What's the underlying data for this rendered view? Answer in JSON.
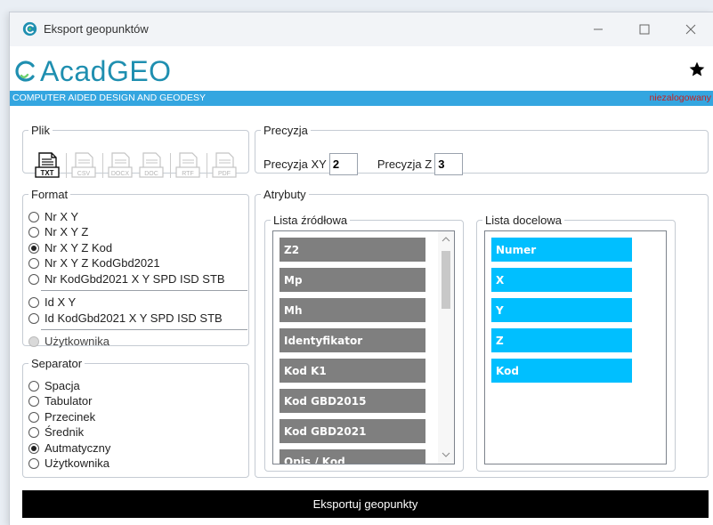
{
  "window": {
    "title": "Eksport geopunktów",
    "minimize_icon": "minimize-icon",
    "maximize_icon": "maximize-icon",
    "close_icon": "close-icon"
  },
  "header": {
    "logo_text": "AcadGEO",
    "tagline": "COMPUTER AIDED DESIGN AND GEODESY",
    "login_status": "niezalogowany",
    "favorite_icon": "star-icon"
  },
  "colors": {
    "accent_blue": "#34a6e0",
    "list_blue": "#00bfff",
    "list_gray": "#7f7f7f",
    "logo_color": "#1f8fb0",
    "status_red": "#c81e1e"
  },
  "plik": {
    "legend": "Plik",
    "buttons": [
      {
        "label": "TXT",
        "enabled": true
      },
      {
        "label": "CSV",
        "enabled": false
      },
      {
        "label": "DOCX",
        "enabled": false
      },
      {
        "label": "DOC",
        "enabled": false
      },
      {
        "label": "RTF",
        "enabled": false
      },
      {
        "label": "PDF",
        "enabled": false
      }
    ]
  },
  "precyzja": {
    "legend": "Precyzja",
    "xy_label": "Precyzja XY",
    "xy_value": "2",
    "z_label": "Precyzja Z",
    "z_value": "3"
  },
  "format": {
    "legend": "Format",
    "options": [
      {
        "label": "Nr X Y",
        "checked": false
      },
      {
        "label": "Nr X Y Z",
        "checked": false
      },
      {
        "label": "Nr X Y Z Kod",
        "checked": true
      },
      {
        "label": "Nr X Y Z KodGbd2021",
        "checked": false
      },
      {
        "label": "Nr KodGbd2021 X Y SPD ISD STB",
        "checked": false
      },
      {
        "label": "Id X Y",
        "checked": false
      },
      {
        "label": "Id KodGbd2021 X Y SPD ISD STB",
        "checked": false
      },
      {
        "label": "Użytkownika",
        "checked": false,
        "disabled": true
      }
    ]
  },
  "separator": {
    "legend": "Separator",
    "options": [
      {
        "label": "Spacja",
        "checked": false
      },
      {
        "label": "Tabulator",
        "checked": false
      },
      {
        "label": "Przecinek",
        "checked": false
      },
      {
        "label": "Średnik",
        "checked": false
      },
      {
        "label": "Autmatyczny",
        "checked": true
      },
      {
        "label": "Użytkownika",
        "checked": false
      }
    ]
  },
  "atrybuty": {
    "legend": "Atrybuty",
    "source_legend": "Lista źródłowa",
    "source_items": [
      "Z2",
      "Mp",
      "Mh",
      "Identyfikator",
      "Kod K1",
      "Kod GBD2015",
      "Kod GBD2021",
      "Opis / Kod"
    ],
    "target_legend": "Lista docelowa",
    "target_items": [
      "Numer",
      "X",
      "Y",
      "Z",
      "Kod"
    ]
  },
  "footer": {
    "export_label": "Eksportuj geopunkty"
  }
}
